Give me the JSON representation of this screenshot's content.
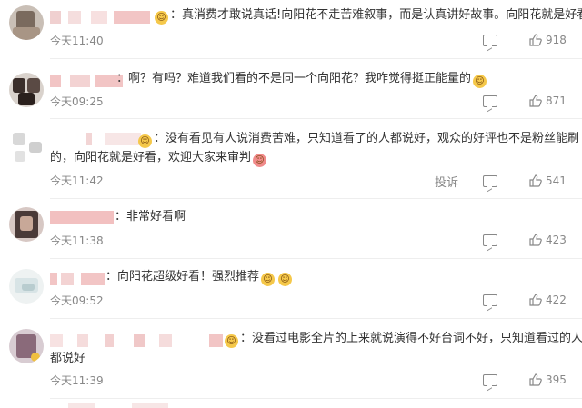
{
  "comments": [
    {
      "text": "：真消费才敢说真话!向阳花不走苦难叙事，而是认真讲好故事。向阳花就是好看",
      "text2": "",
      "time": "今天11:40",
      "likes": "918"
    },
    {
      "text": "：啊？有吗？难道我们看的不是同一个向阳花？我咋觉得挺正能量的",
      "text2": "",
      "time": "今天09:25",
      "likes": "871"
    },
    {
      "text": "：没有看见有人说消费苦难，只知道看了的人都说好，观众的好评也不是粉丝能刷",
      "text2": "的，向阳花就是好看，欢迎大家来审判",
      "time": "今天11:42",
      "likes": "541",
      "report": "投诉"
    },
    {
      "text": "：非常好看啊",
      "text2": "",
      "time": "今天11:38",
      "likes": "423"
    },
    {
      "text": "：向阳花超级好看！强烈推荐",
      "text2": "",
      "time": "今天09:52",
      "likes": "422"
    },
    {
      "text": "：没看过电影全片的上来就说演得不好台词不好，只知道看过的人",
      "text2": "都说好",
      "time": "今天11:39",
      "likes": "395"
    }
  ],
  "icons": {
    "reply": "reply-icon",
    "like": "thumbs-up-icon",
    "emoji": "emoji-icon"
  },
  "colors": {
    "text": "#333333",
    "meta": "#888888",
    "blur_pink": "#f3c9c9"
  }
}
